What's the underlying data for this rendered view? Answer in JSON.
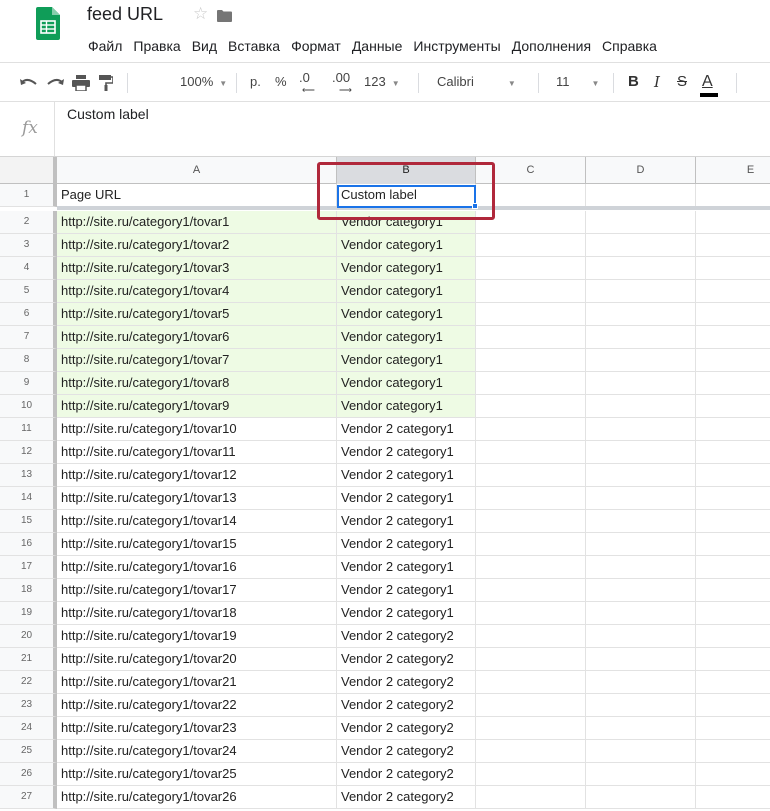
{
  "app": {
    "title": "feed URL",
    "menu": [
      "Файл",
      "Правка",
      "Вид",
      "Вставка",
      "Формат",
      "Данные",
      "Инструменты",
      "Дополнения",
      "Справка"
    ]
  },
  "toolbar": {
    "zoom": "100%",
    "currency": "р.",
    "percent": "%",
    "dec_decrease": ".0",
    "dec_increase": ".00",
    "format_more": "123",
    "font": "Calibri",
    "font_size": "11",
    "bold": "B",
    "italic": "I",
    "text_color": "A"
  },
  "formula_bar": {
    "fx": "fx",
    "value": "Custom label"
  },
  "grid": {
    "columns": [
      "A",
      "B",
      "C",
      "D",
      "E"
    ],
    "active_column": "B",
    "selected_cell": "B1",
    "colors": {
      "green_fill": "#eefbe4",
      "selection": "#1a73e8",
      "annotation_box": "#b0283b"
    },
    "rows": [
      {
        "n": "1",
        "a": "Page URL",
        "b": "Custom label"
      },
      {
        "n": "2",
        "a": "http://site.ru/category1/tovar1",
        "b": "Vendor category1"
      },
      {
        "n": "3",
        "a": "http://site.ru/category1/tovar2",
        "b": "Vendor category1"
      },
      {
        "n": "4",
        "a": "http://site.ru/category1/tovar3",
        "b": "Vendor category1"
      },
      {
        "n": "5",
        "a": "http://site.ru/category1/tovar4",
        "b": "Vendor category1"
      },
      {
        "n": "6",
        "a": "http://site.ru/category1/tovar5",
        "b": "Vendor category1"
      },
      {
        "n": "7",
        "a": "http://site.ru/category1/tovar6",
        "b": "Vendor category1"
      },
      {
        "n": "8",
        "a": "http://site.ru/category1/tovar7",
        "b": "Vendor category1"
      },
      {
        "n": "9",
        "a": "http://site.ru/category1/tovar8",
        "b": "Vendor category1"
      },
      {
        "n": "10",
        "a": "http://site.ru/category1/tovar9",
        "b": "Vendor category1"
      },
      {
        "n": "11",
        "a": "http://site.ru/category1/tovar10",
        "b": "Vendor 2 category1"
      },
      {
        "n": "12",
        "a": "http://site.ru/category1/tovar11",
        "b": "Vendor 2 category1"
      },
      {
        "n": "13",
        "a": "http://site.ru/category1/tovar12",
        "b": "Vendor 2 category1"
      },
      {
        "n": "14",
        "a": "http://site.ru/category1/tovar13",
        "b": "Vendor 2 category1"
      },
      {
        "n": "15",
        "a": "http://site.ru/category1/tovar14",
        "b": "Vendor 2 category1"
      },
      {
        "n": "16",
        "a": "http://site.ru/category1/tovar15",
        "b": "Vendor 2 category1"
      },
      {
        "n": "17",
        "a": "http://site.ru/category1/tovar16",
        "b": "Vendor 2 category1"
      },
      {
        "n": "18",
        "a": "http://site.ru/category1/tovar17",
        "b": "Vendor 2 category1"
      },
      {
        "n": "19",
        "a": "http://site.ru/category1/tovar18",
        "b": "Vendor 2 category1"
      },
      {
        "n": "20",
        "a": "http://site.ru/category1/tovar19",
        "b": "Vendor 2 category2"
      },
      {
        "n": "21",
        "a": "http://site.ru/category1/tovar20",
        "b": "Vendor 2 category2"
      },
      {
        "n": "22",
        "a": "http://site.ru/category1/tovar21",
        "b": "Vendor 2 category2"
      },
      {
        "n": "23",
        "a": "http://site.ru/category1/tovar22",
        "b": "Vendor 2 category2"
      },
      {
        "n": "24",
        "a": "http://site.ru/category1/tovar23",
        "b": "Vendor 2 category2"
      },
      {
        "n": "25",
        "a": "http://site.ru/category1/tovar24",
        "b": "Vendor 2 category2"
      },
      {
        "n": "26",
        "a": "http://site.ru/category1/tovar25",
        "b": "Vendor 2 category2"
      },
      {
        "n": "27",
        "a": "http://site.ru/category1/tovar26",
        "b": "Vendor 2 category2"
      }
    ]
  }
}
